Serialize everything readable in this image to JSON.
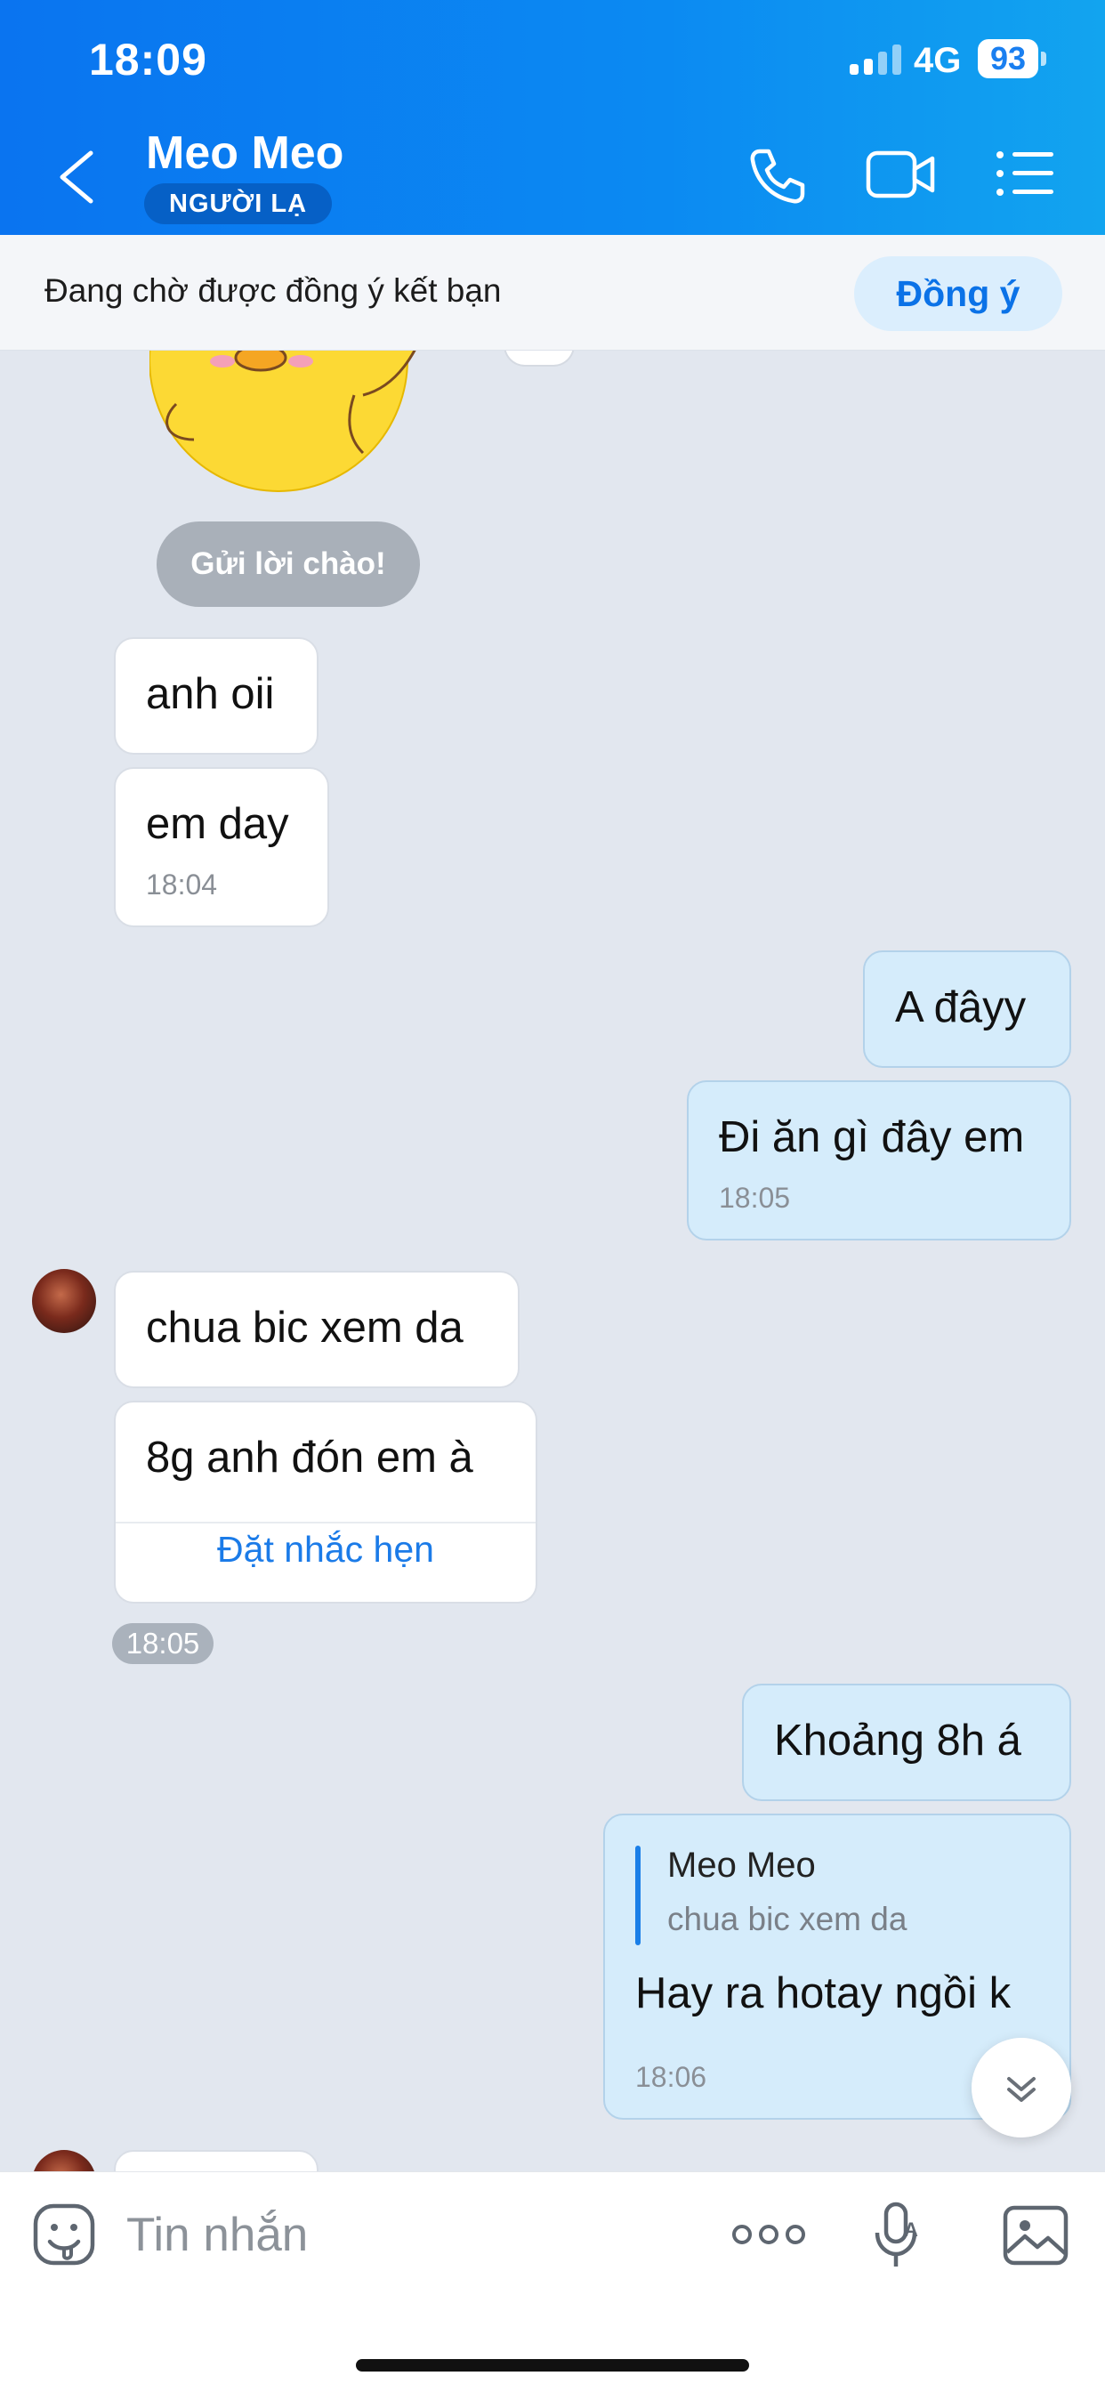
{
  "status_bar": {
    "time": "18:09",
    "network": "4G",
    "battery": "93"
  },
  "header": {
    "contact_name": "Meo Meo",
    "badge": "NGƯỜI LẠ",
    "icons": [
      "back-icon",
      "phone-icon",
      "video-call-icon",
      "menu-list-icon"
    ]
  },
  "request_bar": {
    "text": "Đang chờ được đồng ý kết bạn",
    "accept_label": "Đồng ý"
  },
  "chat": {
    "greet_button": "Gửi lời chào!",
    "messages": [
      {
        "from": "them",
        "text": "anh oii"
      },
      {
        "from": "them",
        "text": "em day",
        "time": "18:04"
      },
      {
        "from": "me",
        "text": "A đâyy"
      },
      {
        "from": "me",
        "text": "Đi ăn gì đây em",
        "time": "18:05"
      },
      {
        "from": "them",
        "text": "chua bic xem da"
      },
      {
        "from": "them",
        "text": "8g anh đón em à",
        "action": "Đặt nhắc hẹn"
      },
      {
        "from": "them",
        "time_pill": "18:05"
      },
      {
        "from": "me",
        "text": "Khoảng 8h á"
      },
      {
        "from": "me",
        "quote_name": "Meo Meo",
        "quote_text": "chua bic xem da",
        "text": "Hay ra hotay ngồi k",
        "time": "18:06"
      }
    ]
  },
  "input_bar": {
    "placeholder": "Tin nhắn"
  },
  "colors": {
    "header_blue": "#0b8af2",
    "outgoing_bubble": "#d5ecfb",
    "accent_link": "#1b7be8"
  }
}
